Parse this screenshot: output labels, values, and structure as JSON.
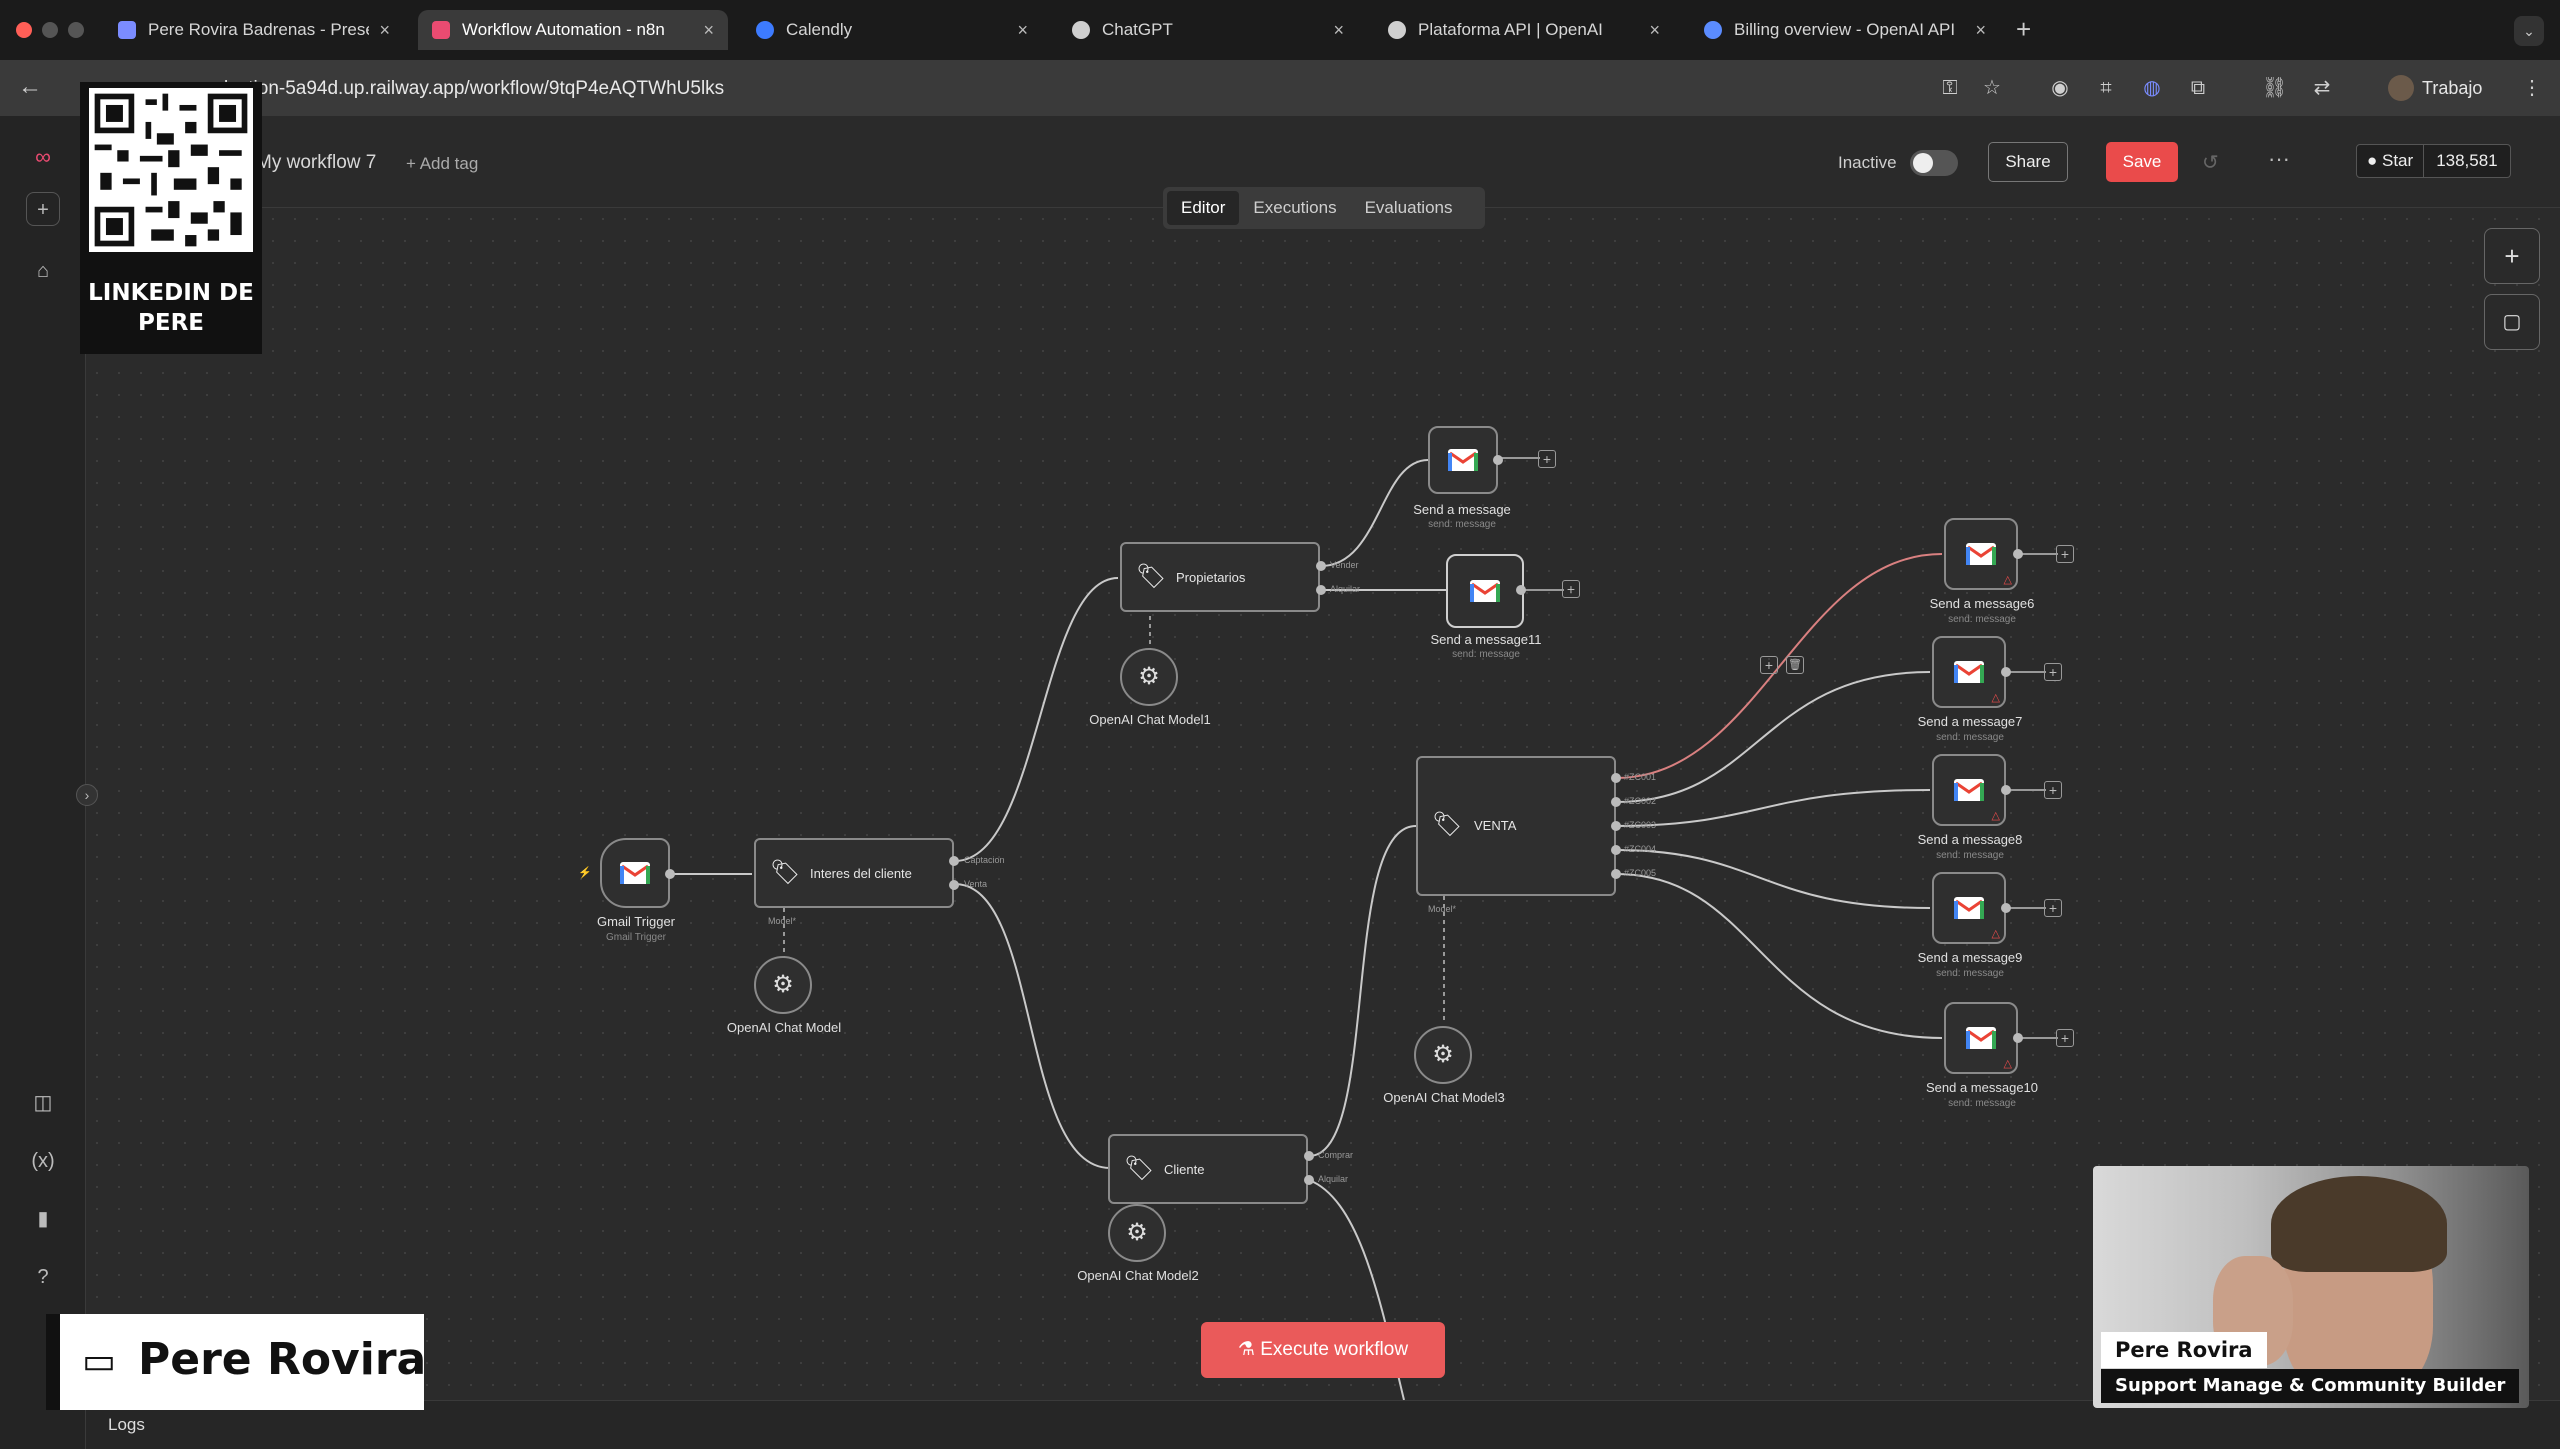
{
  "browser": {
    "tabs": [
      {
        "label": "Pere Rovira Badrenas - Prese",
        "favicon_color": "#7b8cff"
      },
      {
        "label": "Workflow Automation - n8n",
        "favicon_color": "#ea4b71"
      },
      {
        "label": "Calendly",
        "favicon_color": "#3d7bff"
      },
      {
        "label": "ChatGPT",
        "favicon_color": "#cfcfcf"
      },
      {
        "label": "Plataforma API | OpenAI",
        "favicon_color": "#cfcfcf"
      },
      {
        "label": "Billing overview - OpenAI API",
        "favicon_color": "#5b8cff"
      }
    ],
    "new_tab": "+",
    "url": "ry-production-5a94d.up.railway.app/workflow/9tqP4eAQTWhU5lks",
    "profile": "Trabajo"
  },
  "header": {
    "workflow_name": "My workflow 7",
    "add_tag": "+ Add tag",
    "tabs": [
      "Editor",
      "Executions",
      "Evaluations"
    ],
    "active_tab": "Editor",
    "status": "Inactive",
    "share": "Share",
    "save": "Save",
    "more": "···",
    "star": "Star",
    "star_count": "138,581"
  },
  "nodes": {
    "gmail_trigger": {
      "title": "Gmail Trigger",
      "sub": "Gmail Trigger"
    },
    "interes": {
      "label": "Interes del cliente",
      "out1": "Captacion",
      "out2": "Venta",
      "model": "Model*"
    },
    "chat_model": {
      "title": "OpenAI Chat Model"
    },
    "propietarios": {
      "label": "Propietarios",
      "out1": "Vender",
      "out2": "Alquilar"
    },
    "chat_model1": {
      "title": "OpenAI Chat Model1"
    },
    "send_message": {
      "title": "Send a message",
      "sub": "send: message"
    },
    "send_message11": {
      "title": "Send a message11",
      "sub": "send: message"
    },
    "venta": {
      "label": "VENTA",
      "out1": "#ZC001",
      "out2": "#ZC002",
      "out3": "#ZC003",
      "out4": "#ZC004",
      "out5": "#ZC005",
      "model": "Model*"
    },
    "chat_model3": {
      "title": "OpenAI Chat Model3"
    },
    "cliente": {
      "label": "Cliente",
      "out1": "Comprar",
      "out2": "Alquilar"
    },
    "chat_model2": {
      "title": "OpenAI Chat Model2"
    },
    "send_message6": {
      "title": "Send a message6",
      "sub": "send: message"
    },
    "send_message7": {
      "title": "Send a message7",
      "sub": "send: message"
    },
    "send_message8": {
      "title": "Send a message8",
      "sub": "send: message"
    },
    "send_message9": {
      "title": "Send a message9",
      "sub": "send: message"
    },
    "send_message10": {
      "title": "Send a message10",
      "sub": "send: message"
    }
  },
  "execute": "Execute workflow",
  "logs": "Logs",
  "overlays": {
    "qr_caption": "LINKEDIN DE PERE",
    "presenter": "Pere Rovira",
    "cam_name": "Pere Rovira",
    "cam_role": "Support Manage & Community Builder"
  },
  "colors": {
    "accent": "#ea4b4b",
    "edge": "#c9c9c9",
    "edge_active": "#d98080"
  }
}
